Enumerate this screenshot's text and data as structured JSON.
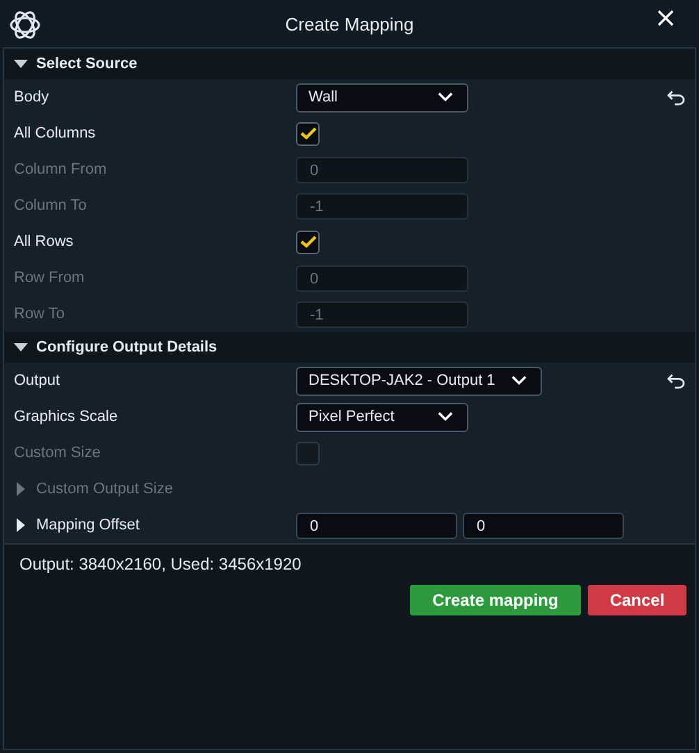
{
  "window": {
    "title": "Create Mapping"
  },
  "sections": [
    {
      "title": "Select Source",
      "expanded": true,
      "rows": [
        {
          "kind": "select",
          "label": "Body",
          "value": "Wall",
          "disabled": false,
          "resettable": true
        },
        {
          "kind": "checkbox",
          "label": "All Columns",
          "checked": true,
          "disabled": false
        },
        {
          "kind": "input",
          "label": "Column From",
          "value": "0",
          "disabled": true
        },
        {
          "kind": "input",
          "label": "Column To",
          "value": "-1",
          "disabled": true
        },
        {
          "kind": "checkbox",
          "label": "All Rows",
          "checked": true,
          "disabled": false
        },
        {
          "kind": "input",
          "label": "Row From",
          "value": "0",
          "disabled": true
        },
        {
          "kind": "input",
          "label": "Row To",
          "value": "-1",
          "disabled": true
        }
      ]
    },
    {
      "title": "Configure Output Details",
      "expanded": true,
      "rows": [
        {
          "kind": "select",
          "label": "Output",
          "value": "DESKTOP-JAK2 - Output 1",
          "disabled": false,
          "resettable": true,
          "wide": true
        },
        {
          "kind": "select",
          "label": "Graphics Scale",
          "value": "Pixel Perfect",
          "disabled": false,
          "resettable": false
        },
        {
          "kind": "checkbox",
          "label": "Custom Size",
          "checked": false,
          "disabled": true
        },
        {
          "kind": "expander",
          "label": "Custom Output Size",
          "expanded": false,
          "disabled": true
        },
        {
          "kind": "pair",
          "label": "Mapping Offset",
          "expanded": false,
          "disabled": false,
          "values": [
            "0",
            "0"
          ]
        }
      ]
    }
  ],
  "summary": "Output: 3840x2160, Used: 3456x1920",
  "buttons": [
    {
      "kind": "primary",
      "label": "Create mapping"
    },
    {
      "kind": "danger",
      "label": "Cancel"
    }
  ]
}
